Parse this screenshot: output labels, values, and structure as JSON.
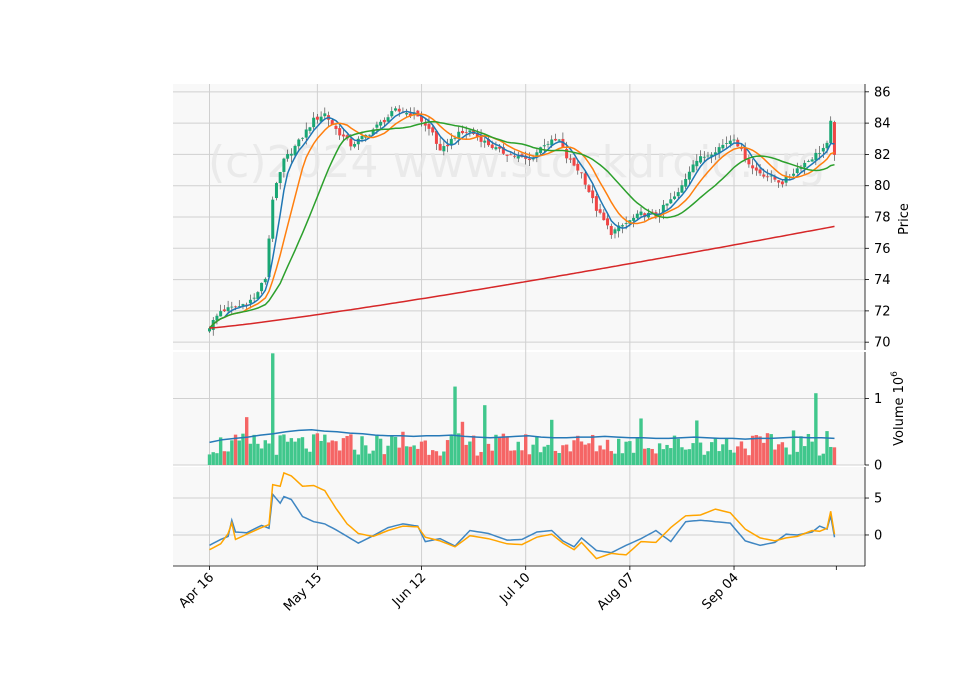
{
  "chart_data": {
    "type": "candlestick",
    "watermark": "(c)2024 www.stockdroid.org",
    "x_tick_labels": [
      "Apr 16",
      "May 15",
      "Jun 12",
      "Jul 10",
      "Aug 07",
      "Sep 04"
    ],
    "x_tick_index": [
      0,
      29,
      57,
      85,
      113,
      141
    ],
    "n_bars": 169,
    "price_panel": {
      "ylabel": "Price",
      "ylim": [
        69.5,
        86.5
      ],
      "yticks": [
        "70",
        "72",
        "74",
        "76",
        "78",
        "80",
        "82",
        "84",
        "86"
      ],
      "ytick_values": [
        70,
        72,
        74,
        76,
        78,
        80,
        82,
        84,
        86
      ],
      "up_color": "#1aa774",
      "down_color": "#f04545",
      "ma_colors": [
        "#1f77b4",
        "#ff7f0e",
        "#2ca02c",
        "#d62728"
      ],
      "close_anchors": [
        [
          0,
          71.0
        ],
        [
          3,
          72.0
        ],
        [
          8,
          72.3
        ],
        [
          12,
          72.8
        ],
        [
          15,
          74.1
        ],
        [
          17,
          79.2
        ],
        [
          20,
          81.6
        ],
        [
          24,
          82.8
        ],
        [
          28,
          84.2
        ],
        [
          31,
          84.6
        ],
        [
          34,
          83.6
        ],
        [
          38,
          82.6
        ],
        [
          42,
          83.2
        ],
        [
          46,
          84.0
        ],
        [
          50,
          84.8
        ],
        [
          56,
          84.5
        ],
        [
          58,
          83.8
        ],
        [
          60,
          83.4
        ],
        [
          62,
          82.1
        ],
        [
          66,
          83.2
        ],
        [
          70,
          83.5
        ],
        [
          74,
          82.8
        ],
        [
          78,
          82.2
        ],
        [
          82,
          81.9
        ],
        [
          86,
          81.6
        ],
        [
          90,
          82.7
        ],
        [
          94,
          82.9
        ],
        [
          96,
          81.8
        ],
        [
          100,
          80.8
        ],
        [
          104,
          78.5
        ],
        [
          108,
          77.0
        ],
        [
          112,
          77.6
        ],
        [
          116,
          78.2
        ],
        [
          120,
          78.1
        ],
        [
          122,
          78.6
        ],
        [
          126,
          79.5
        ],
        [
          130,
          81.5
        ],
        [
          134,
          82.0
        ],
        [
          138,
          82.6
        ],
        [
          141,
          83.1
        ],
        [
          143,
          82.2
        ],
        [
          146,
          81.1
        ],
        [
          150,
          80.6
        ],
        [
          154,
          80.2
        ],
        [
          158,
          81.1
        ],
        [
          162,
          81.8
        ],
        [
          166,
          82.6
        ],
        [
          167,
          84.0
        ],
        [
          168,
          82.1
        ]
      ],
      "ma_periods": [
        5,
        10,
        20,
        100
      ]
    },
    "volume_panel": {
      "ylabel": "Volume  10^6",
      "ylim": [
        0,
        1.7
      ],
      "yticks": [
        "0",
        "1"
      ],
      "ytick_values": [
        0,
        1
      ],
      "up_color": "#40c78c",
      "down_color": "#f56565",
      "ma_color": "#2679b7",
      "ma_values": [
        0.34,
        0.38,
        0.4,
        0.42,
        0.45,
        0.47,
        0.5,
        0.52,
        0.53,
        0.51,
        0.5,
        0.48,
        0.47,
        0.45,
        0.44,
        0.44,
        0.43,
        0.44,
        0.44,
        0.45,
        0.43,
        0.42,
        0.41,
        0.42,
        0.43,
        0.44,
        0.42,
        0.41,
        0.41,
        0.42,
        0.42,
        0.43,
        0.42,
        0.41,
        0.41,
        0.4,
        0.4,
        0.41,
        0.42,
        0.41,
        0.4,
        0.4,
        0.39,
        0.4,
        0.4,
        0.41,
        0.42,
        0.41,
        0.41,
        0.4
      ],
      "spikes": [
        [
          17,
          1.68
        ],
        [
          10,
          0.72
        ],
        [
          52,
          0.5
        ],
        [
          66,
          1.18
        ],
        [
          68,
          0.65
        ],
        [
          74,
          0.9
        ],
        [
          92,
          0.68
        ],
        [
          116,
          0.7
        ],
        [
          131,
          0.67
        ],
        [
          157,
          0.52
        ],
        [
          163,
          1.08
        ],
        [
          166,
          0.51
        ]
      ],
      "base_range": [
        0.14,
        0.48
      ]
    },
    "indicator_panel": {
      "ylim": [
        -4.2,
        9.2
      ],
      "yticks": [
        "0",
        "5"
      ],
      "ytick_values": [
        0,
        5
      ],
      "line_colors": [
        "#3f86c2",
        "#ffa500"
      ],
      "blue_anchors": [
        [
          0,
          -1.4
        ],
        [
          3,
          -0.6
        ],
        [
          5,
          -0.2
        ],
        [
          6,
          2.0
        ],
        [
          7,
          0.4
        ],
        [
          10,
          0.3
        ],
        [
          14,
          1.3
        ],
        [
          16,
          0.9
        ],
        [
          17,
          5.5
        ],
        [
          19,
          4.3
        ],
        [
          20,
          5.2
        ],
        [
          22,
          4.8
        ],
        [
          25,
          2.5
        ],
        [
          28,
          1.8
        ],
        [
          31,
          1.5
        ],
        [
          34,
          0.7
        ],
        [
          37,
          -0.2
        ],
        [
          40,
          -1.1
        ],
        [
          44,
          -0.1
        ],
        [
          48,
          1.0
        ],
        [
          52,
          1.5
        ],
        [
          56,
          1.2
        ],
        [
          58,
          -0.9
        ],
        [
          62,
          -0.5
        ],
        [
          66,
          -1.5
        ],
        [
          70,
          0.6
        ],
        [
          75,
          0.2
        ],
        [
          80,
          -0.7
        ],
        [
          84,
          -0.6
        ],
        [
          88,
          0.4
        ],
        [
          92,
          0.6
        ],
        [
          95,
          -0.8
        ],
        [
          98,
          -1.6
        ],
        [
          100,
          -0.4
        ],
        [
          104,
          -2.1
        ],
        [
          108,
          -2.4
        ],
        [
          112,
          -1.4
        ],
        [
          116,
          -0.5
        ],
        [
          120,
          0.6
        ],
        [
          124,
          -0.9
        ],
        [
          128,
          1.8
        ],
        [
          132,
          2.0
        ],
        [
          136,
          1.8
        ],
        [
          140,
          1.6
        ],
        [
          144,
          -0.8
        ],
        [
          148,
          -1.4
        ],
        [
          152,
          -1.0
        ],
        [
          155,
          0.1
        ],
        [
          158,
          0.0
        ],
        [
          162,
          0.4
        ],
        [
          164,
          1.2
        ],
        [
          166,
          0.8
        ],
        [
          167,
          2.6
        ],
        [
          168,
          -0.3
        ]
      ],
      "orange_anchors": [
        [
          0,
          -2.0
        ],
        [
          3,
          -1.2
        ],
        [
          5,
          0.2
        ],
        [
          6,
          1.6
        ],
        [
          7,
          -0.6
        ],
        [
          10,
          0.1
        ],
        [
          14,
          1.0
        ],
        [
          16,
          1.4
        ],
        [
          17,
          6.8
        ],
        [
          19,
          6.6
        ],
        [
          20,
          8.4
        ],
        [
          22,
          8.0
        ],
        [
          25,
          6.6
        ],
        [
          28,
          6.7
        ],
        [
          31,
          6.0
        ],
        [
          34,
          3.6
        ],
        [
          37,
          1.5
        ],
        [
          40,
          0.2
        ],
        [
          44,
          -0.2
        ],
        [
          48,
          0.6
        ],
        [
          52,
          1.2
        ],
        [
          56,
          1.1
        ],
        [
          58,
          -0.3
        ],
        [
          62,
          -0.8
        ],
        [
          66,
          -1.6
        ],
        [
          70,
          -0.1
        ],
        [
          75,
          -0.5
        ],
        [
          80,
          -1.2
        ],
        [
          84,
          -1.3
        ],
        [
          88,
          -0.3
        ],
        [
          92,
          0.1
        ],
        [
          95,
          -1.1
        ],
        [
          98,
          -2.0
        ],
        [
          100,
          -1.0
        ],
        [
          104,
          -3.2
        ],
        [
          108,
          -2.5
        ],
        [
          112,
          -2.7
        ],
        [
          116,
          -0.9
        ],
        [
          120,
          -1.0
        ],
        [
          124,
          1.0
        ],
        [
          128,
          2.6
        ],
        [
          132,
          2.7
        ],
        [
          136,
          3.5
        ],
        [
          140,
          3.0
        ],
        [
          144,
          0.8
        ],
        [
          148,
          -0.4
        ],
        [
          152,
          -0.8
        ],
        [
          155,
          -0.4
        ],
        [
          158,
          -0.2
        ],
        [
          162,
          0.6
        ],
        [
          164,
          0.5
        ],
        [
          166,
          0.9
        ],
        [
          167,
          3.2
        ],
        [
          168,
          0.1
        ]
      ]
    }
  }
}
